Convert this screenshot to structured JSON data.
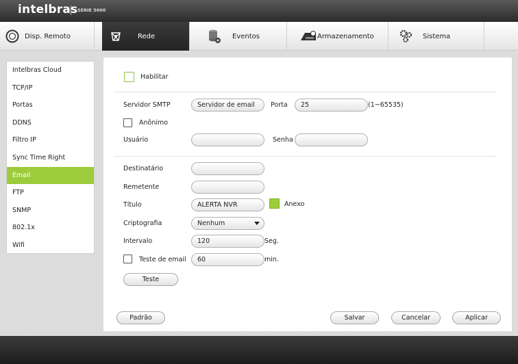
{
  "header": {
    "brand": "intelbras",
    "series": "SÉRIE 5000"
  },
  "nav": [
    {
      "label": "Disp. Remoto",
      "icon": "remote-device-icon"
    },
    {
      "label": "Rede",
      "icon": "network-icon"
    },
    {
      "label": "Eventos",
      "icon": "events-icon"
    },
    {
      "label": "Armazenamento",
      "icon": "storage-icon"
    },
    {
      "label": "Sistema",
      "icon": "system-gear-icon"
    }
  ],
  "sidebar": {
    "items": [
      "Intelbras Cloud",
      "TCP/IP",
      "Portas",
      "DDNS",
      "Filtro IP",
      "Sync Time Right",
      "Email",
      "FTP",
      "SNMP",
      "802.1x",
      "Wifi"
    ],
    "active": "Email"
  },
  "form": {
    "enable_label": "Habilitar",
    "smtp_label": "Servidor SMTP",
    "smtp_value": "Servidor de email",
    "port_label": "Porta",
    "port_value": "25",
    "port_range": "(1~65535)",
    "anonymous_label": "Anônimo",
    "user_label": "Usuário",
    "user_value": "",
    "password_label": "Senha",
    "password_value": "",
    "recipient_label": "Destinatário",
    "recipient_value": "",
    "sender_label": "Remetente",
    "sender_value": "",
    "title_label": "Título",
    "title_value": "ALERTA NVR",
    "attachment_label": "Anexo",
    "encryption_label": "Criptografia",
    "encryption_value": "Nenhum",
    "interval_label": "Intervalo",
    "interval_value": "120",
    "interval_unit": "Seg.",
    "test_email_label": "Teste de email",
    "test_email_value": "60",
    "test_email_unit": "min.",
    "test_button": "Teste"
  },
  "footer_buttons": {
    "default": "Padrão",
    "save": "Salvar",
    "cancel": "Cancelar",
    "apply": "Aplicar"
  },
  "colors": {
    "accent": "#9ccc3c",
    "dark_bar": "#2b2b2b"
  }
}
